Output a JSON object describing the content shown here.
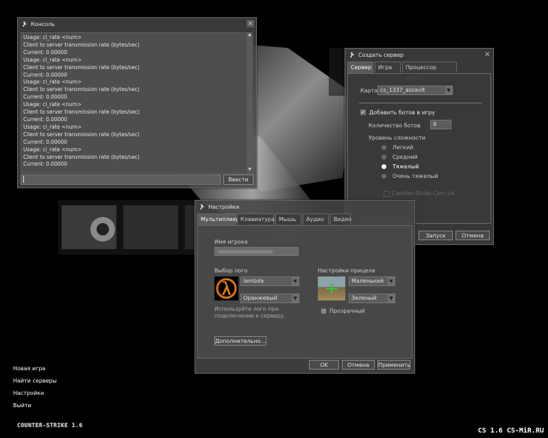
{
  "console": {
    "title": "Консоль",
    "lines": [
      "Usage:  cl_rate <num>",
      "Client to server transmission rate (bytes/sec)",
      "Current:  0.00000",
      "Usage:  cl_rate <num>",
      "Client to server transmission rate (bytes/sec)",
      "Current:  0.00000",
      "Usage:  cl_rate <num>",
      "Client to server transmission rate (bytes/sec)",
      "Current:  0.00000",
      "Usage:  cl_rate <num>",
      "Client to server transmission rate (bytes/sec)",
      "Current:  0.00000",
      "Usage:  cl_rate <num>",
      "Client to server transmission rate (bytes/sec)",
      "Current:  0.00000",
      "Usage:  cl_rate <num>",
      "Client to server transmission rate (bytes/sec)",
      "Current:  0.00000"
    ],
    "input_value": "",
    "submit_label": "Ввести"
  },
  "create_server": {
    "title": "Создать сервер",
    "tabs": [
      "Сервер",
      "Игра",
      "Процессор игрока"
    ],
    "map_label": "Карта",
    "map_value": "cs_1337_assault",
    "add_bots_label": "Добавить ботов в игру",
    "add_bots_checked": true,
    "bot_count_label": "Количество ботов",
    "bot_count_value": "9",
    "difficulty_label": "Уровень сложности",
    "difficulty_options": [
      "Легкий",
      "Средний",
      "Тяжелый",
      "Очень тяжелый"
    ],
    "difficulty_selected": 2,
    "bottom_check_label": "Counter-Strike.Com.Ua",
    "start_label": "Запуск",
    "cancel_label": "Отмена"
  },
  "settings": {
    "title": "Настройки",
    "tabs": [
      "Мультиплеер",
      "Клавиатура",
      "Мышь",
      "Аудио",
      "Видео"
    ],
    "player_name_label": "Имя игрока",
    "logo_label": "Выбор лого",
    "logo_name": "lambda",
    "logo_color": "Оранжевый",
    "logo_hint_line1": "Используйте лого при",
    "logo_hint_line2": "подключении к серверу.",
    "crosshair_label": "Настройки прицела",
    "crosshair_size": "Маленький",
    "crosshair_color": "Зеленый",
    "transparent_label": "Прозрачный",
    "advanced_label": "Дополнительно...",
    "ok_label": "OK",
    "cancel_label": "Отмена",
    "apply_label": "Применить"
  },
  "main_menu": {
    "items": [
      "Новая игра",
      "Найти серверы",
      "Настройки",
      "Выйти"
    ]
  },
  "logo_text": "COUNTER-STRIKE 1.6",
  "watermark": "CS 1.6 CS-MiR.RU",
  "colors": {
    "window_bg": "#464646",
    "accent_orange": "#e07a10",
    "text": "#d8d8d8"
  }
}
